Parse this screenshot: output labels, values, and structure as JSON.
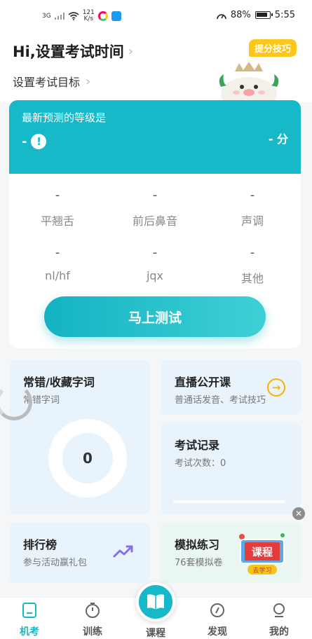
{
  "status_bar": {
    "network": "3G",
    "speed_value": "121",
    "speed_unit": "K/s",
    "battery": "88%",
    "battery_level": 0.88,
    "time": "5:55"
  },
  "header": {
    "title": "Hi,设置考试时间",
    "subtitle": "设置考试目标",
    "tip_badge": "提分技巧"
  },
  "prediction": {
    "label": "最新预测的等级是",
    "level": "-",
    "warn_symbol": "!",
    "score": "-",
    "score_unit": "分",
    "items": [
      {
        "value": "-",
        "name": "平翘舌"
      },
      {
        "value": "-",
        "name": "前后鼻音"
      },
      {
        "value": "-",
        "name": "声调"
      },
      {
        "value": "-",
        "name": "nl/hf"
      },
      {
        "value": "-",
        "name": "jqx"
      },
      {
        "value": "-",
        "name": "其他"
      }
    ],
    "test_button": "马上测试"
  },
  "tiles": {
    "wrong_words": {
      "title": "常错/收藏字词",
      "subtitle": "常错字词",
      "count": "0"
    },
    "live": {
      "title": "直播公开课",
      "subtitle": "普通话发音、考试技巧"
    },
    "records": {
      "title": "考试记录",
      "subtitle": "考试次数：0"
    },
    "ranking": {
      "title": "排行榜",
      "subtitle": "参与活动赢礼包"
    },
    "mock": {
      "title": "模拟练习",
      "subtitle": "76套模拟卷",
      "badge_main": "课程",
      "badge_sub": "去学习"
    }
  },
  "nav": {
    "items": [
      {
        "label": "机考"
      },
      {
        "label": "训练"
      },
      {
        "label": "课程"
      },
      {
        "label": "发现"
      },
      {
        "label": "我的"
      }
    ]
  },
  "colors": {
    "accent": "#17b8c7",
    "tip_badge": "#ffc61a",
    "live_arrow": "#f4b400"
  }
}
